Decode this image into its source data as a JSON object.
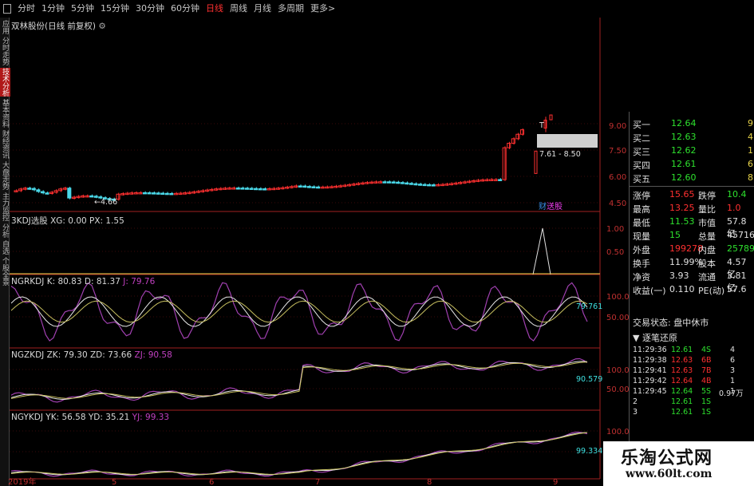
{
  "toolbar": {
    "timeframes": [
      "分时",
      "1分钟",
      "5分钟",
      "15分钟",
      "30分钟",
      "60分钟",
      "日线",
      "周线",
      "月线",
      "多周期",
      "更多>"
    ],
    "active": "日线"
  },
  "sidebar": {
    "tabs": [
      "应用",
      "分时走势",
      "技术分析",
      "基本资料",
      "财经资讯",
      "大盘走势",
      "主力监控",
      "分析",
      "自选",
      "个股全景"
    ]
  },
  "panels": {
    "main": {
      "title": "双林股份(日线 前复权)",
      "price_labels": [
        "9.00",
        "7.50",
        "6.00",
        "4.50"
      ],
      "range_label": "7.61 - 8.50",
      "low_label": "4.66",
      "markers": [
        "财",
        "送股"
      ]
    },
    "p1": {
      "name": "3KDJ选股",
      "kvs": "XG: 0.00  PX: 1.55",
      "scale": [
        "1.00",
        "0.50"
      ]
    },
    "p2": {
      "name": "NGRKDJ",
      "kd": "K: 80.83  D: 81.37",
      "j": "J: 79.76",
      "scale": [
        "100.0",
        "50.00"
      ],
      "value": "79.761"
    },
    "p3": {
      "name": "NGZKDJ",
      "kd": "ZK: 79.30  ZD: 73.66",
      "j": "ZJ: 90.58",
      "scale": [
        "100.0",
        "50.00"
      ],
      "value": "90.579"
    },
    "p4": {
      "name": "NGYKDJ",
      "kd": "YK: 56.58  YD: 35.21",
      "j": "YJ: 99.33",
      "scale": [
        "100.0",
        "50.00"
      ],
      "value": "99.334"
    }
  },
  "x_labels": [
    "2019年",
    "5",
    "6",
    "7",
    "8",
    "9"
  ],
  "orderbook": [
    {
      "label": "买一",
      "price": "12.64",
      "qty": "9"
    },
    {
      "label": "买二",
      "price": "12.63",
      "qty": "4"
    },
    {
      "label": "买三",
      "price": "12.62",
      "qty": "1"
    },
    {
      "label": "买四",
      "price": "12.61",
      "qty": "6"
    },
    {
      "label": "买五",
      "price": "12.60",
      "qty": "8"
    }
  ],
  "stats": [
    {
      "l1": "涨停",
      "v1": "15.65",
      "l2": "跌停",
      "v2": "10.4"
    },
    {
      "l1": "最高",
      "v1": "13.25",
      "l2": "量比",
      "v2": "1.0"
    },
    {
      "l1": "最低",
      "v1": "11.53",
      "l2": "市值",
      "v2": "57.8亿"
    },
    {
      "l1": "现量",
      "v1": "15",
      "l2": "总量",
      "v2": "45716"
    },
    {
      "l1": "外盘",
      "v1": "199278",
      "l2": "内盘",
      "v2": "25789"
    },
    {
      "l1": "换手",
      "v1": "11.99%",
      "l2": "股本",
      "v2": "4.57亿"
    },
    {
      "l1": "净资",
      "v1": "3.93",
      "l2": "流通",
      "v2": "3.81亿"
    },
    {
      "l1": "收益(一)",
      "v1": "0.110",
      "l2": "PE(动)",
      "v2": "57.6"
    }
  ],
  "status": {
    "trade_state": "交易状态: 盘中休市",
    "mode": "逐笔还原"
  },
  "ticks": [
    {
      "time": "11:29:36",
      "price": "12.61",
      "vol": "4",
      "s": "S",
      "n": "4"
    },
    {
      "time": "11:29:38",
      "price": "12.63",
      "vol": "6",
      "s": "B",
      "n": "6"
    },
    {
      "time": "11:29:41",
      "price": "12.63",
      "vol": "7",
      "s": "B",
      "n": "3"
    },
    {
      "time": "11:29:42",
      "price": "12.64",
      "vol": "4",
      "s": "B",
      "n": "1"
    },
    {
      "time": "11:29:45",
      "price": "12.64",
      "vol": "5",
      "s": "S",
      "n": "1"
    },
    {
      "time": "2",
      "price": "12.61",
      "vol": "1",
      "s": "S",
      "n": ""
    },
    {
      "time": "3",
      "price": "12.61",
      "vol": "1",
      "s": "S",
      "n": ""
    }
  ],
  "tick_extra": "0.97万",
  "watermark": {
    "cn": "乐淘公式网",
    "url": "www.60lt.com"
  }
}
